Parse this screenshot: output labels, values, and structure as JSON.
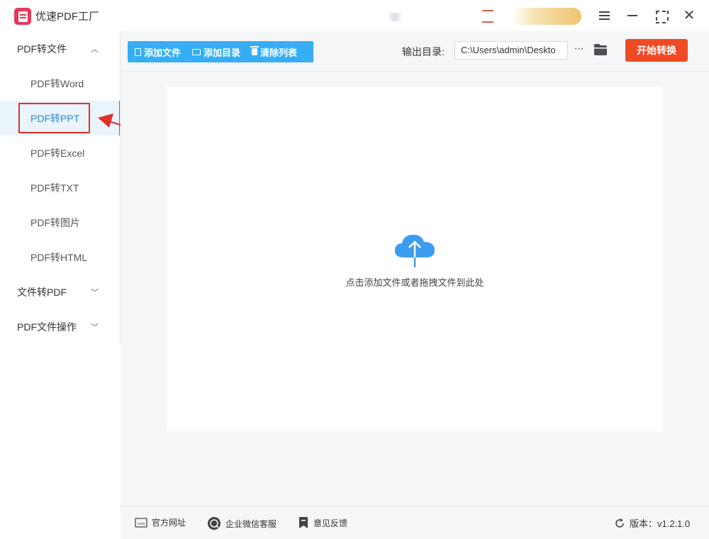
{
  "app": {
    "title": "优速PDF工厂"
  },
  "sidebar": {
    "groups": [
      {
        "label": "PDF转文件",
        "chevron": "^"
      },
      {
        "label": "文件转PDF",
        "chevron": "⌄"
      },
      {
        "label": "PDF文件操作",
        "chevron": "⌄"
      }
    ],
    "items": [
      {
        "label": "PDF转Word"
      },
      {
        "label": "PDF转PPT",
        "active": true
      },
      {
        "label": "PDF转Excel"
      },
      {
        "label": "PDF转TXT"
      },
      {
        "label": "PDF转图片"
      },
      {
        "label": "PDF转HTML"
      }
    ]
  },
  "toolbar": {
    "add_file": "添加文件",
    "add_folder": "添加目录",
    "clear_list": "清除列表",
    "output_label": "输出目录:",
    "output_path": "C:\\Users\\admin\\Deskto",
    "more": "···",
    "start": "开始转换"
  },
  "dropzone": {
    "hint": "点击添加文件或者拖拽文件到此处",
    "icon": "cloud-upload-icon"
  },
  "footer": {
    "website": "官方网址",
    "wechat": "企业微信客服",
    "feedback": "意见反馈",
    "version_label": "版本：v1.2.1.0"
  },
  "colors": {
    "accent_blue": "#36aef6",
    "start_red": "#f04a25",
    "active_text": "#2a8ad4",
    "annotation_red": "#e0312b",
    "logo": "#e5385a"
  }
}
